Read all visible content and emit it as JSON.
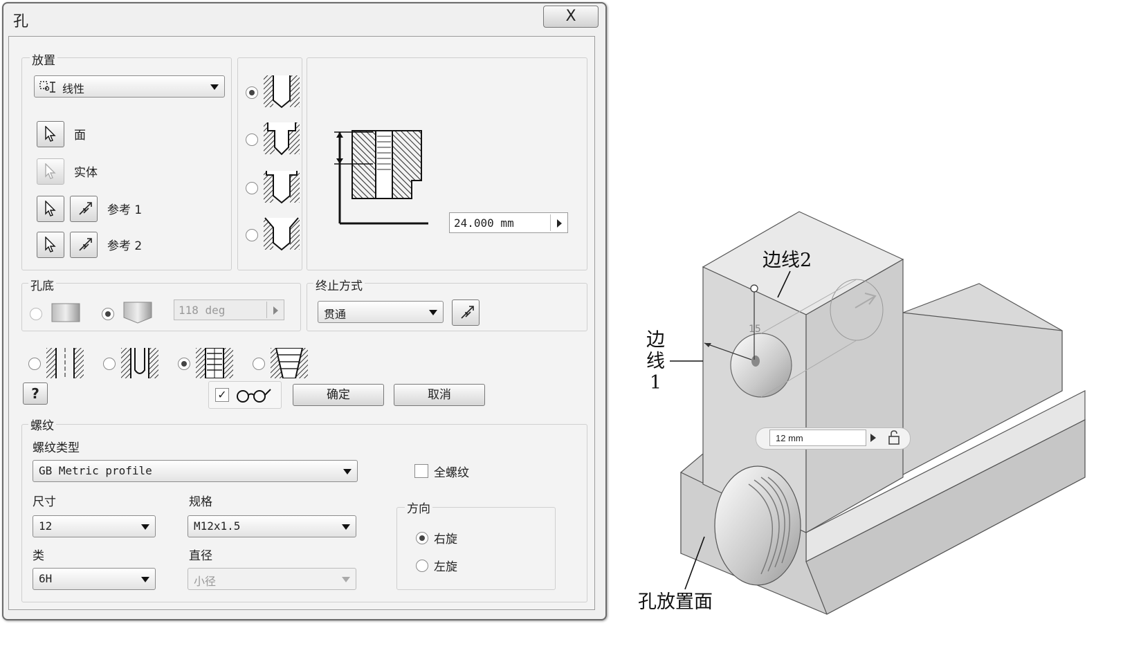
{
  "window": {
    "title": "孔",
    "close_glyph": "X"
  },
  "placement": {
    "group_label": "放置",
    "mode": "线性",
    "face_label": "面",
    "solid_label": "实体",
    "ref1_label": "参考 1",
    "ref2_label": "参考 2"
  },
  "preview": {
    "depth_value": "24.000 mm"
  },
  "hole_bottom": {
    "group_label": "孔底",
    "angle": "118 deg"
  },
  "termination": {
    "group_label": "终止方式",
    "value": "贯通"
  },
  "buttons": {
    "ok": "确定",
    "cancel": "取消"
  },
  "thread": {
    "group_label": "螺纹",
    "type_label": "螺纹类型",
    "type_value": "GB Metric profile",
    "full_thread_label": "全螺纹",
    "size_label": "尺寸",
    "size_value": "12",
    "designation_label": "规格",
    "designation_value": "M12x1.5",
    "class_label": "类",
    "class_value": "6H",
    "diameter_label": "直径",
    "diameter_value": "小径",
    "direction_label": "方向",
    "right_hand": "右旋",
    "left_hand": "左旋"
  },
  "drawing": {
    "edge2_label": "边线2",
    "edge1_lines": [
      "边",
      "线",
      "1"
    ],
    "placement_face_label": "孔放置面",
    "dimension_value": "15",
    "input_value": "12 mm"
  },
  "colors": {
    "dialog_bg": "#f0f0f0",
    "model_face": "#d6d6d6"
  }
}
